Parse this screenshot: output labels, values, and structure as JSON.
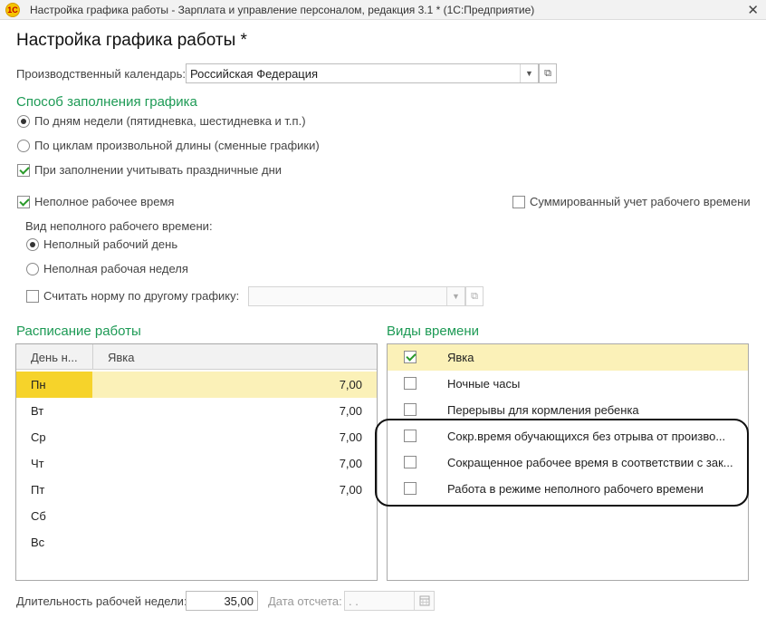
{
  "window": {
    "title": "Настройка графика работы - Зарплата и управление персоналом, редакция 3.1 * (1С:Предприятие)",
    "logo": "1C",
    "close_glyph": "✕"
  },
  "page_title": "Настройка графика работы *",
  "calendar": {
    "label": "Производственный календарь:",
    "value": "Российская Федерация",
    "dropdown_glyph": "▼",
    "open_glyph": "⧉"
  },
  "fill_method": {
    "title": "Способ заполнения графика",
    "options": [
      {
        "label": "По дням недели (пятидневка, шестидневка и т.п.)",
        "selected": true
      },
      {
        "label": "По циклам произвольной длины (сменные графики)",
        "selected": false
      }
    ],
    "holidays": {
      "label": "При заполнении учитывать праздничные дни",
      "checked": true
    }
  },
  "part_time": {
    "label": "Неполное рабочее время",
    "checked": true,
    "summed": {
      "label": "Суммированный учет рабочего времени",
      "checked": false
    },
    "kind_label": "Вид неполного рабочего времени:",
    "kinds": [
      {
        "label": "Неполный рабочий день",
        "selected": true
      },
      {
        "label": "Неполная рабочая неделя",
        "selected": false
      }
    ],
    "other_norm": {
      "label": "Считать норму по другому графику:",
      "checked": false,
      "value": ""
    }
  },
  "schedule": {
    "title": "Расписание работы",
    "columns": [
      "День н...",
      "Явка"
    ],
    "rows": [
      {
        "day": "Пн",
        "hours": "7,00",
        "selected": true
      },
      {
        "day": "Вт",
        "hours": "7,00",
        "selected": false
      },
      {
        "day": "Ср",
        "hours": "7,00",
        "selected": false
      },
      {
        "day": "Чт",
        "hours": "7,00",
        "selected": false
      },
      {
        "day": "Пт",
        "hours": "7,00",
        "selected": false
      },
      {
        "day": "Сб",
        "hours": "",
        "selected": false
      },
      {
        "day": "Вс",
        "hours": "",
        "selected": false
      }
    ]
  },
  "time_types": {
    "title": "Виды времени",
    "items": [
      {
        "label": "Явка",
        "checked": true,
        "selected": true
      },
      {
        "label": "Ночные часы",
        "checked": false,
        "selected": false
      },
      {
        "label": "Перерывы для кормления ребенка",
        "checked": false,
        "selected": false
      },
      {
        "label": "Сокр.время обучающихся без отрыва от произво...",
        "checked": false,
        "selected": false
      },
      {
        "label": "Сокращенное рабочее время в соответствии с зак...",
        "checked": false,
        "selected": false
      },
      {
        "label": "Работа в режиме неполного рабочего времени",
        "checked": false,
        "selected": false
      }
    ]
  },
  "footer": {
    "week_label": "Длительность рабочей недели:",
    "week_value": "35,00",
    "date_label": "Дата отсчета:",
    "date_value": " .  ."
  },
  "colors": {
    "accent_green": "#1d9a55",
    "selection_yellow": "#f6d32a",
    "selection_light": "#fbf1b8"
  }
}
